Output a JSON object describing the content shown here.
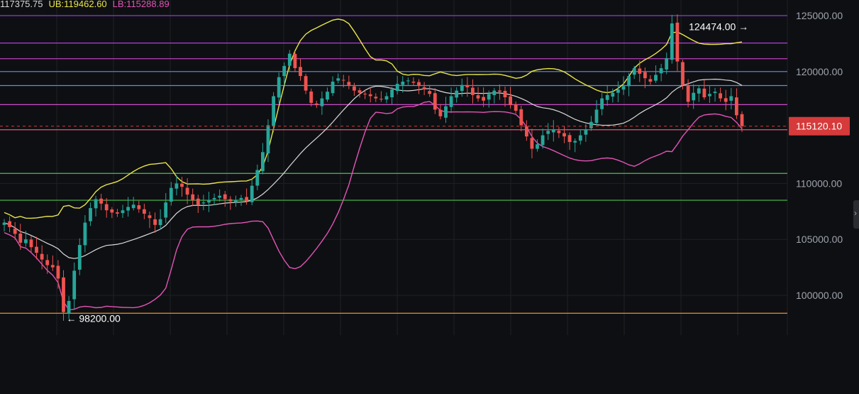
{
  "header": {
    "mid_value": "117375.75",
    "ub_label": "UB:119462.60",
    "lb_label": "LB:115288.89",
    "mid_color": "#d9d9d9",
    "ub_color": "#e8e54a",
    "lb_color": "#e254b7"
  },
  "colors": {
    "background": "#0e0f12",
    "grid": "#1e2026",
    "up_candle": "#26a69a",
    "down_candle": "#ef5350",
    "upper_band": "#e8e54a",
    "lower_band": "#e254b7",
    "middle_band": "#d9d9d9",
    "axis_text": "#9ea3ad",
    "price_badge": "#d63a3a"
  },
  "chart_data": {
    "type": "candlestick",
    "indicator": "Bollinger Bands",
    "y_axis": {
      "min": 96000,
      "max": 126000,
      "ticks": [
        {
          "value": 100000,
          "label": "100000.00"
        },
        {
          "value": 105000,
          "label": "105000.00"
        },
        {
          "value": 110000,
          "label": "110000.00"
        },
        {
          "value": 120000,
          "label": "120000.00"
        },
        {
          "value": 125000,
          "label": "125000.00"
        }
      ]
    },
    "current_price": {
      "value": 115120.1,
      "label": "115120.10"
    },
    "annotations": [
      {
        "name": "high-annotation",
        "text": "124474.00 →",
        "value": 124474,
        "x_index": 139,
        "side": "left"
      },
      {
        "name": "low-annotation",
        "text": "← 98200.00",
        "value": 98200,
        "x_index": 11,
        "side": "right"
      }
    ],
    "horizontal_levels": [
      {
        "value": 125000,
        "color": "#8a3fd1"
      },
      {
        "value": 122550,
        "color": "#b040d8"
      },
      {
        "value": 121150,
        "color": "#c843c9"
      },
      {
        "value": 120000,
        "color": "#5b8fe0"
      },
      {
        "value": 118750,
        "color": "#5b8fe0"
      },
      {
        "value": 117050,
        "color": "#e254e0"
      },
      {
        "value": 114800,
        "color": "#e05b78"
      },
      {
        "value": 110900,
        "color": "#4cc04c"
      },
      {
        "value": 108500,
        "color": "#4cc04c"
      },
      {
        "value": 98400,
        "color": "#f0922b"
      }
    ],
    "closes": [
      106500,
      106100,
      105500,
      104700,
      105000,
      104300,
      103800,
      103200,
      102700,
      102500,
      101500,
      98500,
      99500,
      102200,
      104500,
      106500,
      107800,
      108600,
      108200,
      107600,
      107400,
      107300,
      107600,
      107900,
      108100,
      107700,
      107300,
      106900,
      106300,
      106800,
      108300,
      109600,
      110000,
      109700,
      109000,
      108500,
      108100,
      108300,
      108500,
      108700,
      108900,
      108600,
      108400,
      108500,
      108700,
      108400,
      109800,
      111200,
      112800,
      115200,
      117800,
      119500,
      120500,
      121600,
      120300,
      119600,
      118300,
      117200,
      117000,
      117600,
      118200,
      119100,
      119400,
      119200,
      118800,
      118300,
      118100,
      118000,
      117800,
      117600,
      117500,
      117800,
      118400,
      118900,
      119100,
      119200,
      119000,
      118700,
      118400,
      118000,
      116600,
      116000,
      116900,
      117800,
      118300,
      118800,
      118600,
      117900,
      117600,
      117400,
      118000,
      118300,
      118200,
      117700,
      117000,
      116500,
      115200,
      114200,
      113100,
      113500,
      114300,
      114700,
      114800,
      114500,
      114200,
      113700,
      113800,
      114300,
      114800,
      115500,
      116600,
      117600,
      117900,
      118100,
      118400,
      118700,
      119600,
      120300,
      119800,
      119400,
      119100,
      119700,
      120300,
      121200,
      124300,
      120900,
      118800,
      117300,
      118100,
      118500,
      117700,
      118000,
      118200,
      117600,
      117300,
      117800,
      116100,
      115120
    ]
  }
}
